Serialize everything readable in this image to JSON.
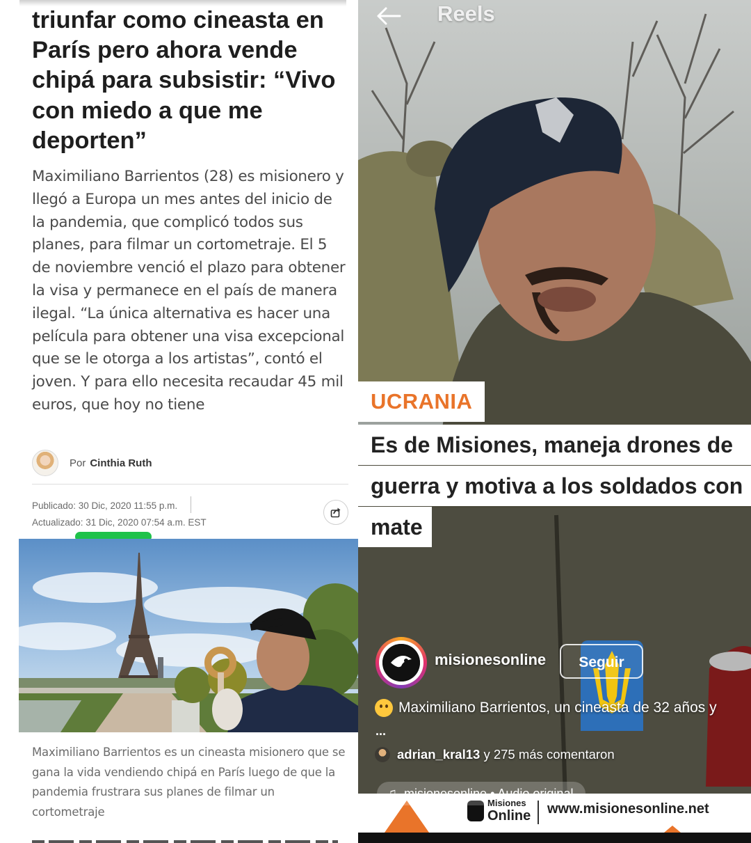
{
  "article": {
    "headline": "triunfar como cineasta en París pero ahora vende chipá para subsistir: “Vivo con miedo a que me deporten”",
    "lead": "Maximiliano Barrientos (28) es misionero y llegó a Europa un mes antes del inicio de la pandemia, que complicó todos sus planes, para filmar un cortometraje. El 5 de noviembre venció el plazo para obtener la visa y permanece en el país de manera ilegal. “La única alternativa es hacer una película para obtener una visa excepcional que se le otorga a los artistas”, contó el joven. Y para ello necesita recaudar 45 mil euros, que hoy no tiene",
    "author_prefix": "Por",
    "author_name": "Cinthia Ruth",
    "published": "Publicado: 30 Dic, 2020 11:55 p.m.",
    "updated": "Actualizado: 31 Dic, 2020 07:54 a.m. EST",
    "share_icon": "share-icon",
    "image_caption": "Maximiliano Barrientos es un cineasta misionero que se gana la vida vendiendo chipá en París luego de que la pandemia frustrara sus planes de filmar un cortometraje",
    "highlight_color": "#1fc24a"
  },
  "reel": {
    "title": "Reels",
    "back_icon": "arrow-left-icon",
    "section_tag": "UCRANIA",
    "section_tag_color": "#e9742a",
    "headline_lines": [
      "Es de Misiones, maneja drones de",
      "guerra y motiva a los soldados con",
      "mate"
    ],
    "username": "misionesonline",
    "follow_label": "Seguir",
    "caption": "Maximiliano Barrientos, un cineasta de 32 años y",
    "caption_more": "...",
    "comments_user": "adrian_kral13",
    "comments_rest": " y 275 más comentaron",
    "audio": "misionesonline • Audio original",
    "brand_line1": "Misiones",
    "brand_line2": "Online",
    "brand_url": "www.misionesonline.net"
  }
}
